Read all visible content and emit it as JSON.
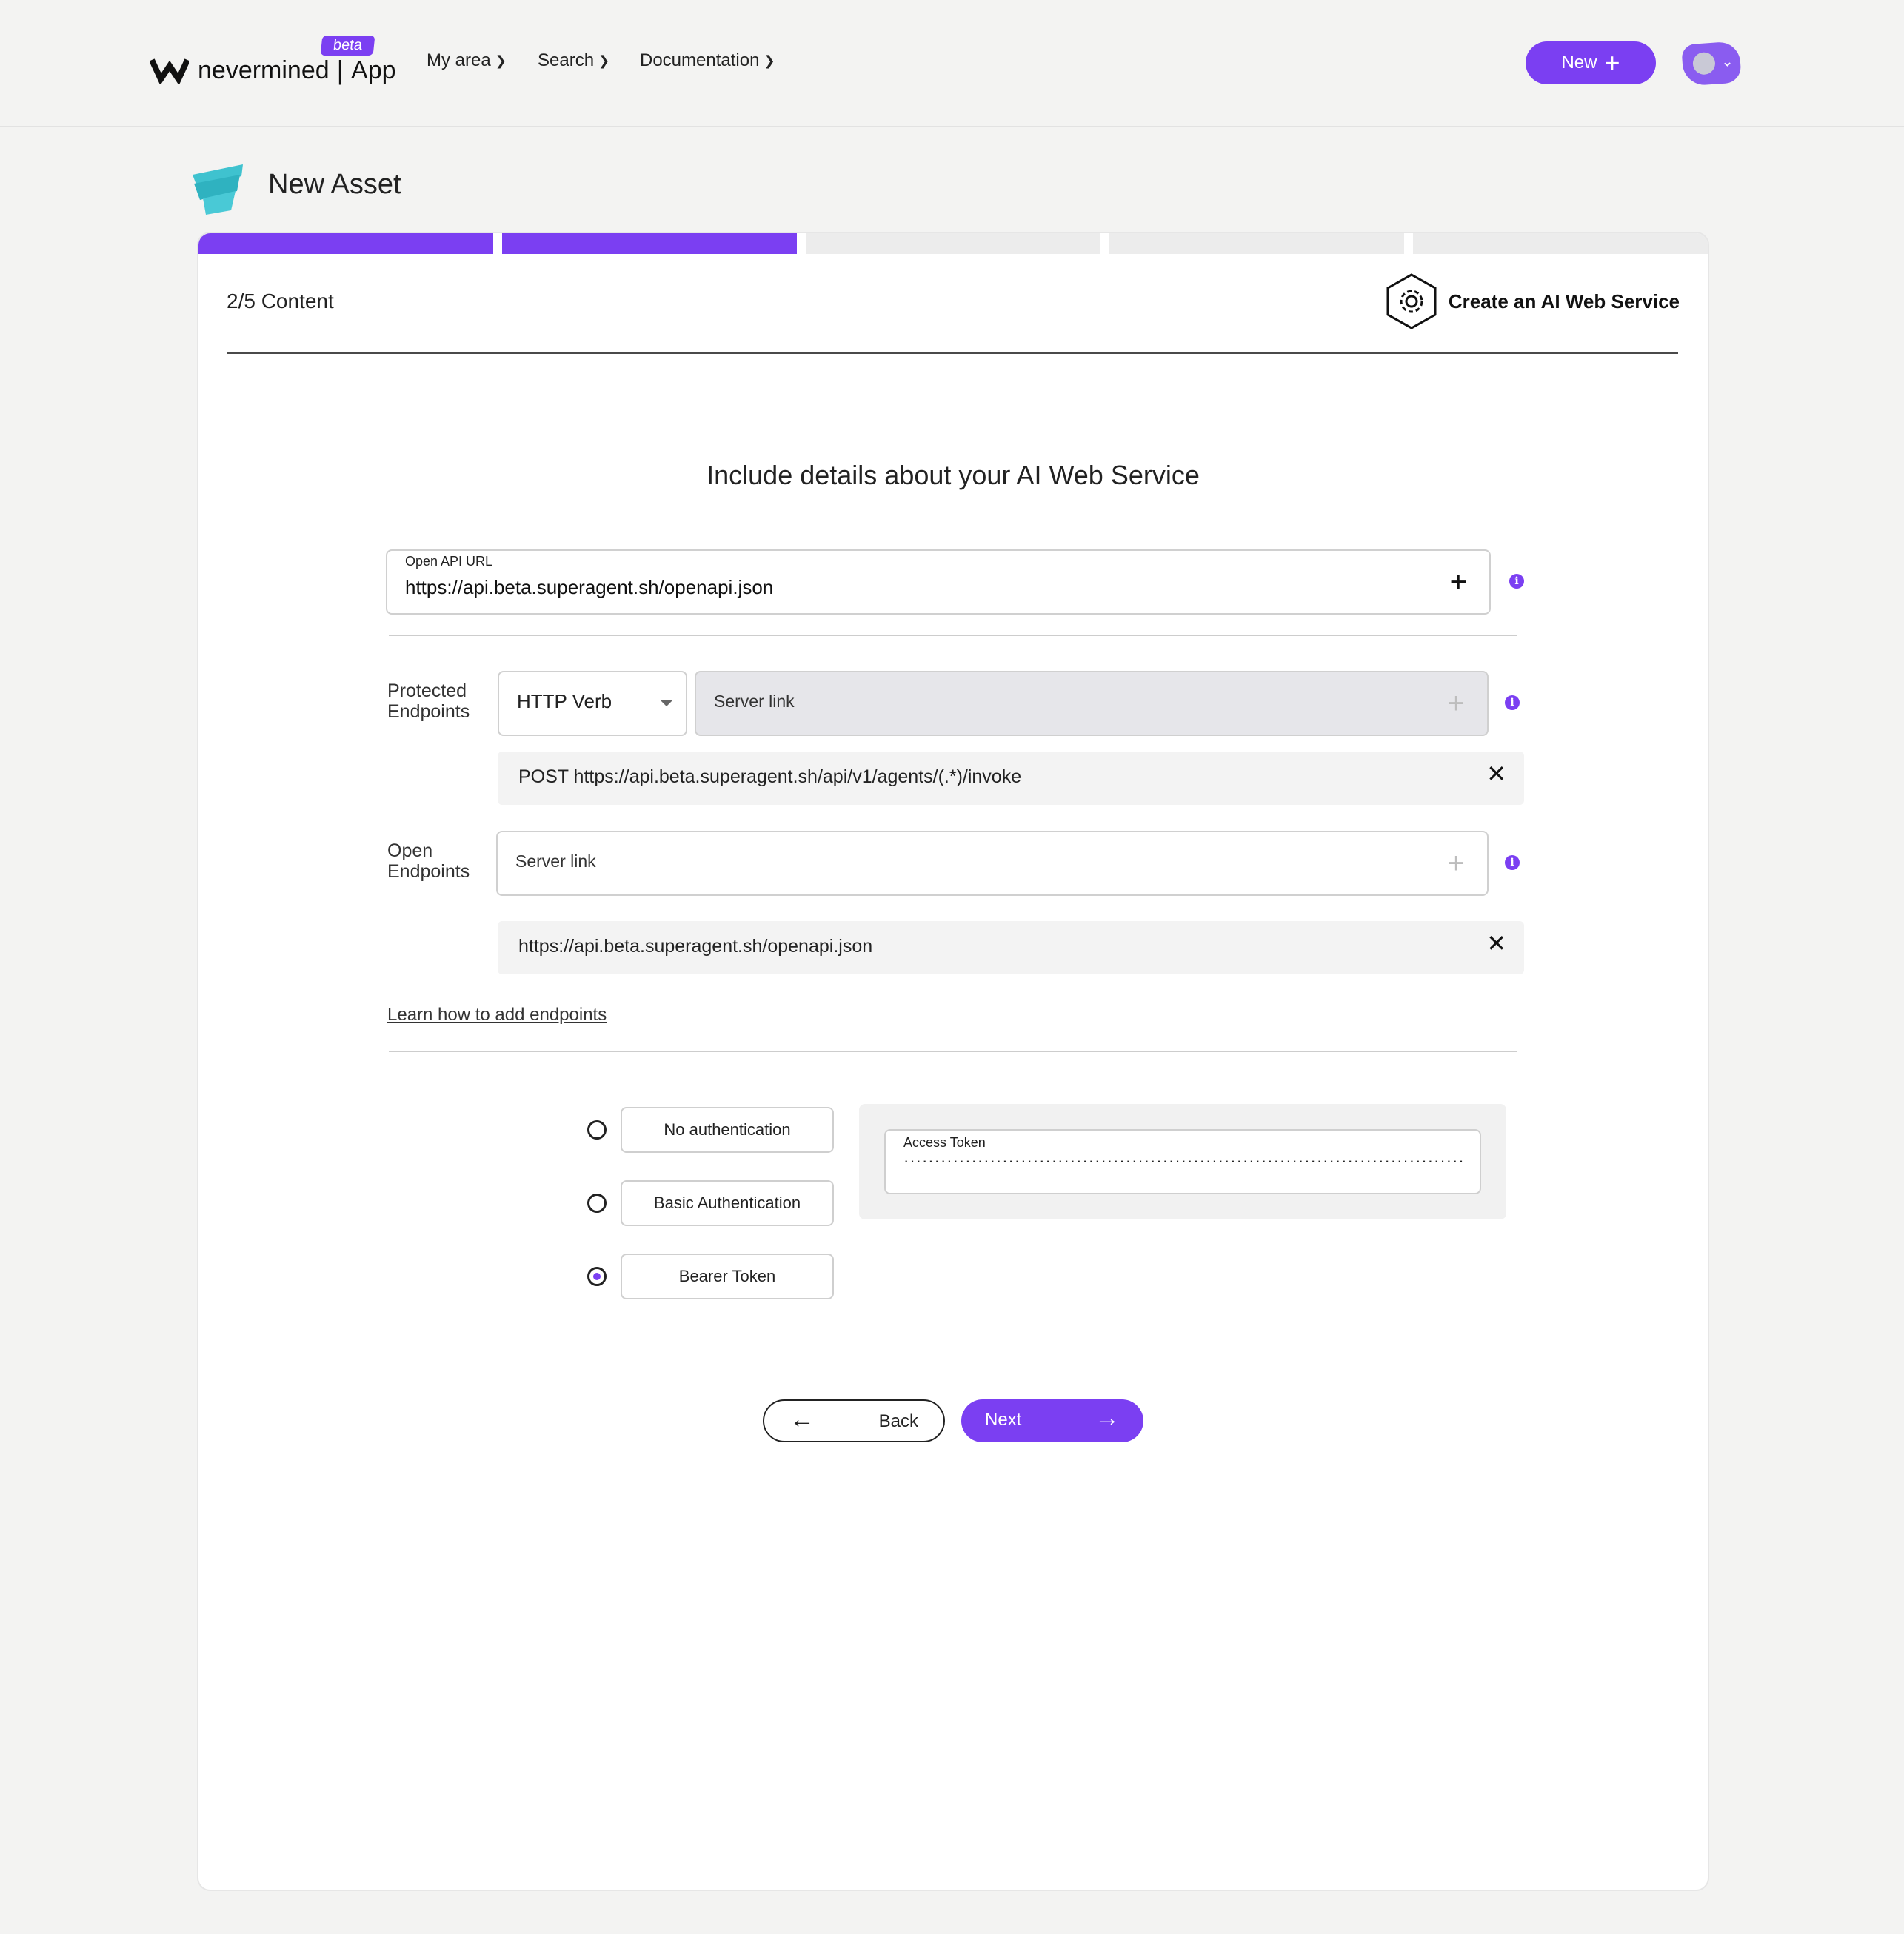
{
  "header": {
    "logo_word": "nevermined",
    "logo_separator": "|",
    "logo_app": "App",
    "beta_badge": "beta",
    "nav": [
      {
        "label": "My area"
      },
      {
        "label": "Search"
      },
      {
        "label": "Documentation"
      }
    ],
    "new_button_label": "New",
    "brand_color": "#7b3ff2"
  },
  "page": {
    "title": "New Asset"
  },
  "wizard": {
    "step_label": "2/5 Content",
    "steps_total": 5,
    "steps_completed": 2,
    "asset_type_label": "Create an AI Web Service",
    "section_title": "Include details about your AI Web Service"
  },
  "openapi": {
    "label": "Open API URL",
    "value": "https://api.beta.superagent.sh/openapi.json"
  },
  "protected_endpoints": {
    "label_line1": "Protected",
    "label_line2": "Endpoints",
    "verb_select": "HTTP Verb",
    "server_placeholder": "Server link",
    "items": [
      {
        "text": "POST https://api.beta.superagent.sh/api/v1/agents/(.*)/invoke"
      }
    ]
  },
  "open_endpoints": {
    "label_line1": "Open",
    "label_line2": "Endpoints",
    "server_placeholder": "Server link",
    "items": [
      {
        "text": "https://api.beta.superagent.sh/openapi.json"
      }
    ]
  },
  "learn_link": "Learn how to add endpoints",
  "auth": {
    "options": [
      {
        "label": "No authentication",
        "selected": false
      },
      {
        "label": "Basic Authentication",
        "selected": false
      },
      {
        "label": "Bearer Token",
        "selected": true
      }
    ],
    "token_label": "Access Token",
    "token_masked": "································································································································"
  },
  "footer_nav": {
    "back_label": "Back",
    "next_label": "Next"
  }
}
